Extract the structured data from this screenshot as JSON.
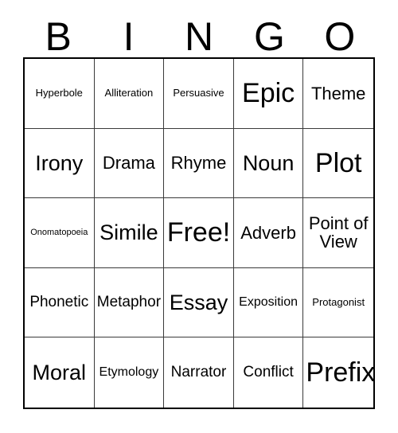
{
  "card": {
    "title": "BINGO",
    "header_letters": [
      "B",
      "I",
      "N",
      "G",
      "O"
    ],
    "rows": [
      [
        {
          "label": "Hyperbole",
          "size": "sm"
        },
        {
          "label": "Alliteration",
          "size": "sm"
        },
        {
          "label": "Persuasive",
          "size": "sm"
        },
        {
          "label": "Epic",
          "size": "huge"
        },
        {
          "label": "Theme",
          "size": "xl"
        }
      ],
      [
        {
          "label": "Irony",
          "size": "xxl"
        },
        {
          "label": "Drama",
          "size": "xl"
        },
        {
          "label": "Rhyme",
          "size": "xl"
        },
        {
          "label": "Noun",
          "size": "xxl"
        },
        {
          "label": "Plot",
          "size": "huge"
        }
      ],
      [
        {
          "label": "Onomatopoeia",
          "size": "xs"
        },
        {
          "label": "Simile",
          "size": "xxl"
        },
        {
          "label": "Free!",
          "size": "huge"
        },
        {
          "label": "Adverb",
          "size": "xl"
        },
        {
          "label": "Point of View",
          "size": "xl"
        }
      ],
      [
        {
          "label": "Phonetic",
          "size": "lg"
        },
        {
          "label": "Metaphor",
          "size": "lg"
        },
        {
          "label": "Essay",
          "size": "xxl"
        },
        {
          "label": "Exposition",
          "size": "md"
        },
        {
          "label": "Protagonist",
          "size": "sm"
        }
      ],
      [
        {
          "label": "Moral",
          "size": "xxl"
        },
        {
          "label": "Etymology",
          "size": "md"
        },
        {
          "label": "Narrator",
          "size": "lg"
        },
        {
          "label": "Conflict",
          "size": "lg"
        },
        {
          "label": "Prefix",
          "size": "huge"
        }
      ]
    ],
    "free_space_label": "Free!",
    "colors": {
      "text": "#000000",
      "background": "#ffffff",
      "grid_line": "#3a3a3a",
      "outer_border": "#000000"
    }
  }
}
